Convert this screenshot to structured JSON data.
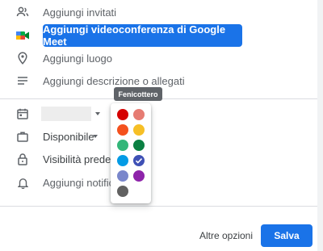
{
  "rows": {
    "guests": "Aggiungi invitati",
    "meet_button": "Aggiungi videoconferenza di Google Meet",
    "location": "Aggiungi luogo",
    "description": "Aggiungi descrizione o allegati",
    "availability": "Disponibile",
    "visibility": "Visibilità predefin",
    "notification": "Aggiungi notifica"
  },
  "tooltip": "Fenicottero",
  "palette": {
    "selected": "Mirtillo",
    "colors": [
      {
        "name": "Pomodoro",
        "hex": "#d50000"
      },
      {
        "name": "Fenicottero",
        "hex": "#e67c73"
      },
      {
        "name": "Mandarino",
        "hex": "#f4511e"
      },
      {
        "name": "Banana",
        "hex": "#f6bf26"
      },
      {
        "name": "Salvia",
        "hex": "#33b679"
      },
      {
        "name": "Basilico",
        "hex": "#0b8043"
      },
      {
        "name": "Pavone",
        "hex": "#039be5"
      },
      {
        "name": "Mirtillo",
        "hex": "#3f51b5"
      },
      {
        "name": "Lavanda",
        "hex": "#7986cb"
      },
      {
        "name": "Vinaccia",
        "hex": "#8e24aa"
      },
      {
        "name": "Grafite",
        "hex": "#616161"
      }
    ]
  },
  "footer": {
    "more_options": "Altre opzioni",
    "save": "Salva"
  },
  "colors": {
    "accent": "#1a73e8"
  }
}
